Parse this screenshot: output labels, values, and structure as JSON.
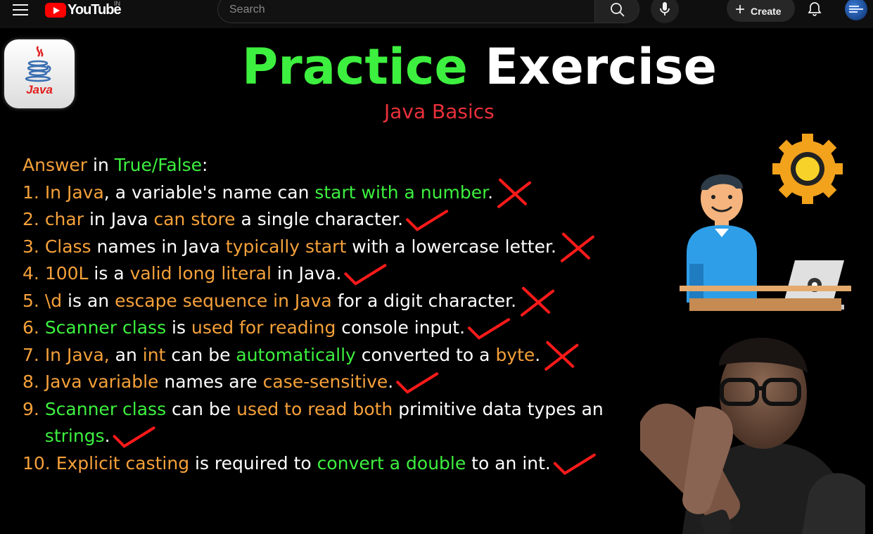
{
  "youtube": {
    "logo_text": "YouTube",
    "region": "IN",
    "search_placeholder": "Search",
    "create_label": "Create"
  },
  "video": {
    "logo_label": "Java",
    "title_part1": "Practice",
    "title_part2": "Exercise",
    "subtitle": "Java Basics",
    "heading": {
      "part1": "Answer",
      "part2": " in ",
      "part3": "True/False",
      "part4": ":"
    },
    "questions": [
      [
        {
          "t": "1. ",
          "c": "o"
        },
        {
          "t": "In Java",
          "c": "o"
        },
        {
          "t": ", a variable's name can ",
          "c": "w"
        },
        {
          "t": "start with a number",
          "c": "g"
        },
        {
          "t": ".",
          "c": "w"
        }
      ],
      [
        {
          "t": "2. ",
          "c": "o"
        },
        {
          "t": "char",
          "c": "o"
        },
        {
          "t": " in Java ",
          "c": "w"
        },
        {
          "t": "can store",
          "c": "o"
        },
        {
          "t": " a single character.",
          "c": "w"
        }
      ],
      [
        {
          "t": "3. ",
          "c": "o"
        },
        {
          "t": "Class",
          "c": "o"
        },
        {
          "t": " names in Java ",
          "c": "w"
        },
        {
          "t": "typically start",
          "c": "o"
        },
        {
          "t": " with a lowercase letter.",
          "c": "w"
        }
      ],
      [
        {
          "t": "4. ",
          "c": "o"
        },
        {
          "t": "100L",
          "c": "o"
        },
        {
          "t": " is a ",
          "c": "w"
        },
        {
          "t": "valid long literal",
          "c": "o"
        },
        {
          "t": " in Java.",
          "c": "w"
        }
      ],
      [
        {
          "t": "5. ",
          "c": "o"
        },
        {
          "t": "\\d",
          "c": "o"
        },
        {
          "t": " is an ",
          "c": "w"
        },
        {
          "t": "escape sequence in Java",
          "c": "o"
        },
        {
          "t": " for a digit character.",
          "c": "w"
        }
      ],
      [
        {
          "t": "6. ",
          "c": "o"
        },
        {
          "t": "Scanner class",
          "c": "g"
        },
        {
          "t": " is ",
          "c": "w"
        },
        {
          "t": "used for reading",
          "c": "o"
        },
        {
          "t": " console input.",
          "c": "w"
        }
      ],
      [
        {
          "t": "7. ",
          "c": "o"
        },
        {
          "t": "In Java,",
          "c": "o"
        },
        {
          "t": " an ",
          "c": "w"
        },
        {
          "t": "int",
          "c": "o"
        },
        {
          "t": " can be ",
          "c": "w"
        },
        {
          "t": "automatically",
          "c": "g"
        },
        {
          "t": " converted to a ",
          "c": "w"
        },
        {
          "t": "byte",
          "c": "o"
        },
        {
          "t": ".",
          "c": "w"
        }
      ],
      [
        {
          "t": "8. ",
          "c": "o"
        },
        {
          "t": "Java variable",
          "c": "o"
        },
        {
          "t": " names are ",
          "c": "w"
        },
        {
          "t": "case-sensitive",
          "c": "o"
        },
        {
          "t": ".",
          "c": "w"
        }
      ],
      [
        {
          "t": "9. ",
          "c": "o"
        },
        {
          "t": "Scanner class",
          "c": "g"
        },
        {
          "t": " can be ",
          "c": "w"
        },
        {
          "t": "used to read both",
          "c": "o"
        },
        {
          "t": " primitive data types an",
          "c": "w"
        }
      ],
      [
        {
          "t": "    ",
          "c": "w"
        },
        {
          "t": "strings",
          "c": "g"
        },
        {
          "t": ".",
          "c": "w"
        }
      ],
      [
        {
          "t": "10. ",
          "c": "o"
        },
        {
          "t": "Explicit casting",
          "c": "o"
        },
        {
          "t": " is required to ",
          "c": "w"
        },
        {
          "t": "convert a double",
          "c": "g"
        },
        {
          "t": " to an int.",
          "c": "w"
        }
      ]
    ],
    "answers": [
      "false",
      "true",
      "false",
      "true",
      "false",
      "true",
      "false",
      "true",
      "true",
      "true"
    ]
  },
  "colors": {
    "title_green": "#3df03f",
    "subtitle_red": "#e9303a",
    "orange": "#f5a13a",
    "mark_red": "#ff1a1a",
    "youtube_red": "#ff0000"
  }
}
